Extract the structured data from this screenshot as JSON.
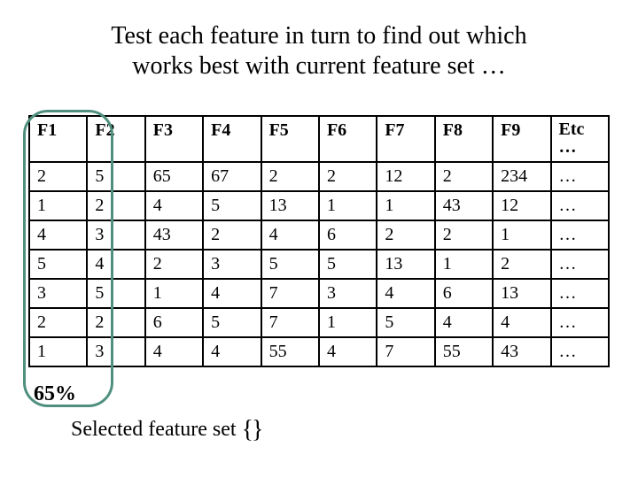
{
  "title_line1": "Test each feature in turn to find out which",
  "title_line2": "works best with current feature set …",
  "headers": [
    "F1",
    "F2",
    "F3",
    "F4",
    "F5",
    "F6",
    "F7",
    "F8",
    "F9"
  ],
  "etc_label": "Etc",
  "etc_sub": "…",
  "rows": [
    [
      "2",
      "5",
      "65",
      "67",
      "2",
      "2",
      "12",
      "2",
      "234",
      "…"
    ],
    [
      "1",
      "2",
      "4",
      "5",
      "13",
      "1",
      "1",
      "43",
      "12",
      "…"
    ],
    [
      "4",
      "3",
      "43",
      "2",
      "4",
      "6",
      "2",
      "2",
      "1",
      "…"
    ],
    [
      "5",
      "4",
      "2",
      "3",
      "5",
      "5",
      "13",
      "1",
      "2",
      "…"
    ],
    [
      "3",
      "5",
      "1",
      "4",
      "7",
      "3",
      "4",
      "6",
      "13",
      "…"
    ],
    [
      "2",
      "2",
      "6",
      "5",
      "7",
      "1",
      "5",
      "4",
      "4",
      "…"
    ],
    [
      "1",
      "3",
      "4",
      "4",
      "55",
      "4",
      "7",
      "55",
      "43",
      "…"
    ]
  ],
  "percent_label": "65%",
  "caption_prefix": "Selected feature set  ",
  "caption_set": "{}"
}
